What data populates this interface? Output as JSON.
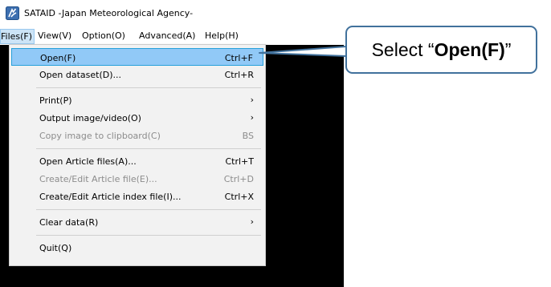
{
  "window": {
    "title": "SATAID -Japan Meteorological Agency-",
    "icon": "sataid-app-icon"
  },
  "menubar": {
    "items": [
      {
        "label": "Files(F)",
        "active": true
      },
      {
        "label": "View(V)"
      },
      {
        "label": "Option(O)"
      },
      {
        "label": "Advanced(A)"
      },
      {
        "label": "Help(H)"
      }
    ]
  },
  "files_menu": {
    "items": [
      {
        "label": "Open(F)",
        "shortcut": "Ctrl+F",
        "highlighted": true
      },
      {
        "label": "Open dataset(D)...",
        "shortcut": "Ctrl+R"
      },
      {
        "label": "Print(P)",
        "submenu": "›"
      },
      {
        "label": "Output image/video(O)",
        "submenu": "›"
      },
      {
        "label": "Copy image to clipboard(C)",
        "shortcut": "BS",
        "disabled": true
      },
      {
        "label": "Open Article files(A)...",
        "shortcut": "Ctrl+T"
      },
      {
        "label": "Create/Edit Article file(E)...",
        "shortcut": "Ctrl+D",
        "disabled": true
      },
      {
        "label": "Create/Edit Article index file(I)...",
        "shortcut": "Ctrl+X"
      },
      {
        "label": "Clear data(R)",
        "submenu": "›"
      },
      {
        "label": "Quit(Q)"
      }
    ]
  },
  "callout": {
    "prefix": "Select “",
    "bold": "Open(F)",
    "suffix": "”",
    "border_color": "#41719c"
  },
  "colors": {
    "highlight": "#91c9f7",
    "canvas": "#000000",
    "menu_bg": "#f2f2f2"
  }
}
